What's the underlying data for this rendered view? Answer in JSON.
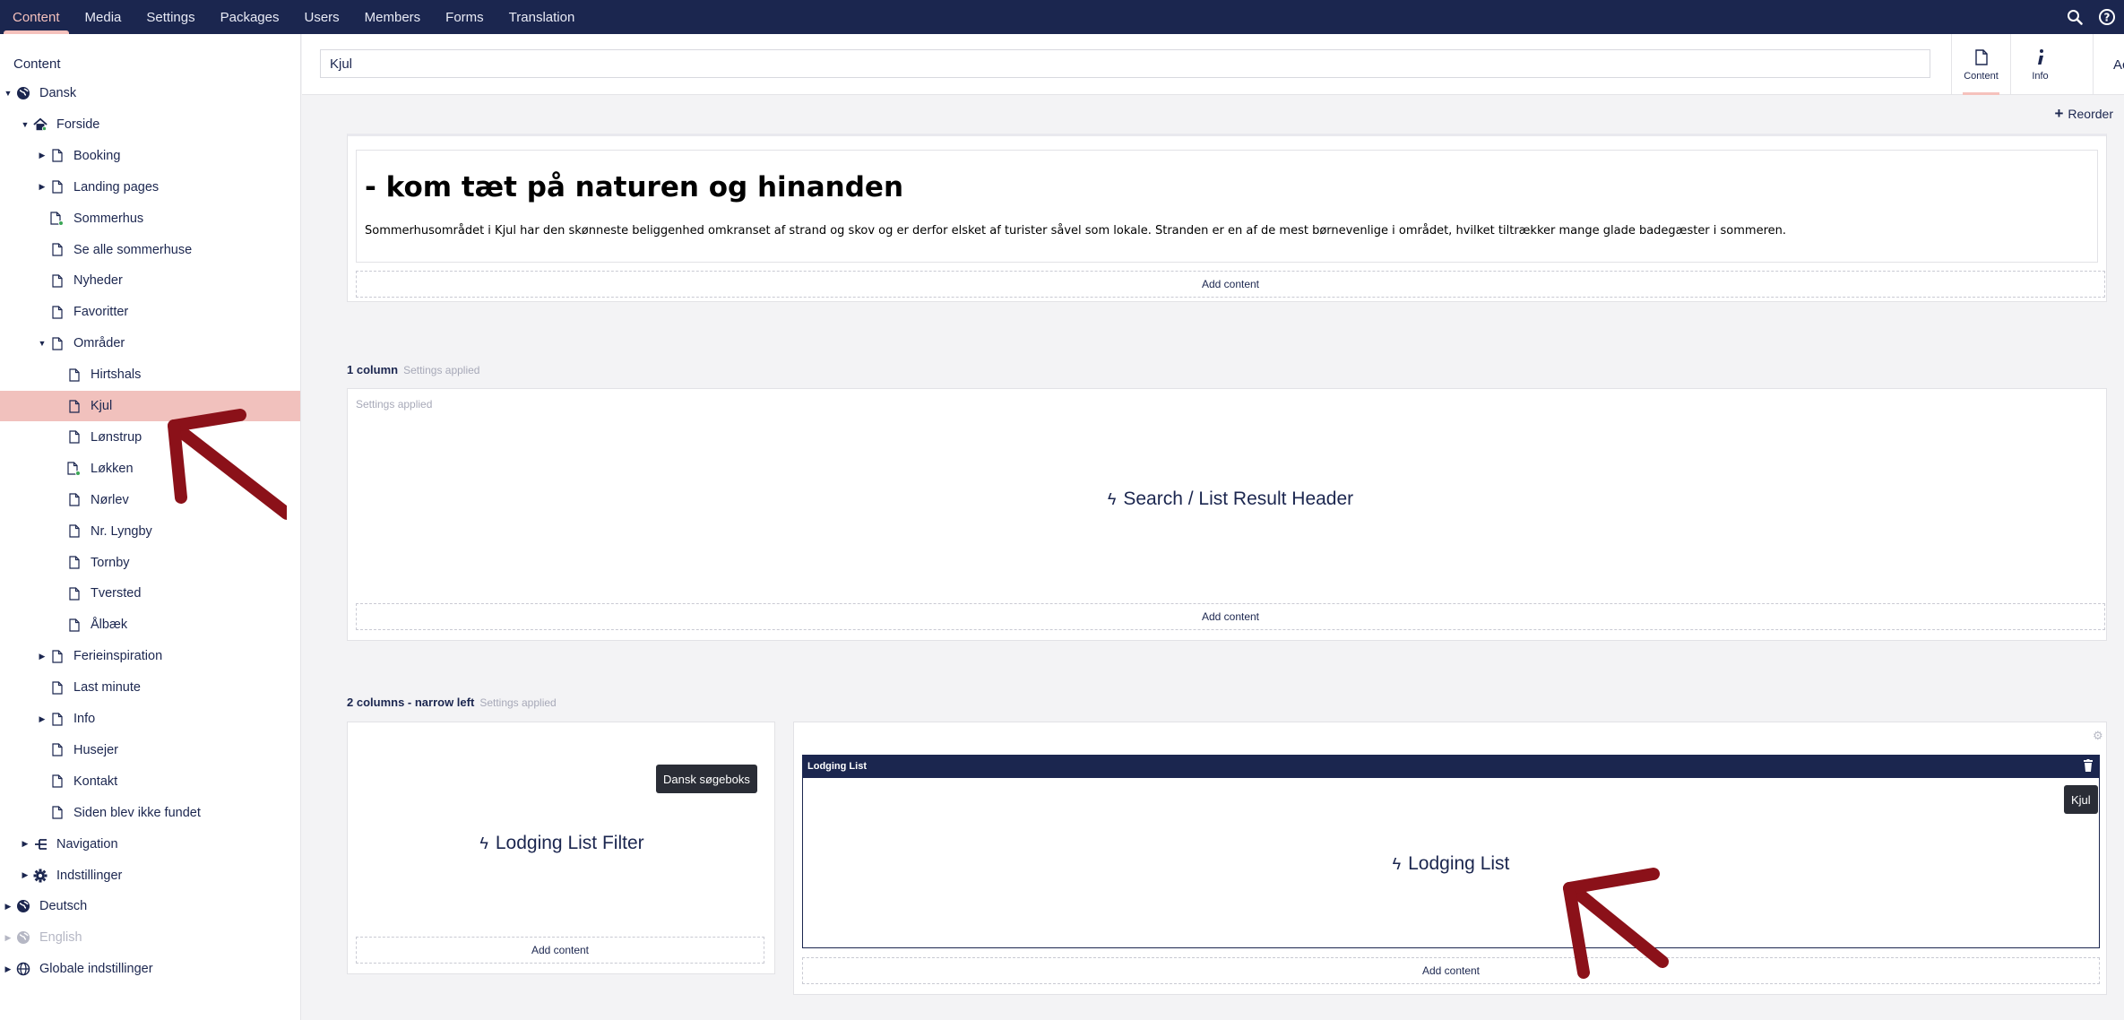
{
  "topnav": {
    "items": [
      "Content",
      "Media",
      "Settings",
      "Packages",
      "Users",
      "Members",
      "Forms",
      "Translation"
    ],
    "active": "Content"
  },
  "sidebar": {
    "title": "Content",
    "tree": [
      {
        "label": "Dansk",
        "icon": "globe-icon",
        "depth": 0,
        "caret": "open"
      },
      {
        "label": "Forside",
        "icon": "home-icon",
        "depth": 1,
        "caret": "open"
      },
      {
        "label": "Booking",
        "icon": "document-icon",
        "depth": 2,
        "caret": "closed"
      },
      {
        "label": "Landing pages",
        "icon": "document-icon",
        "depth": 2,
        "caret": "closed"
      },
      {
        "label": "Sommerhus",
        "icon": "document-dot-icon",
        "depth": 2,
        "caret": "none"
      },
      {
        "label": "Se alle sommerhuse",
        "icon": "document-icon",
        "depth": 2,
        "caret": "none"
      },
      {
        "label": "Nyheder",
        "icon": "document-icon",
        "depth": 2,
        "caret": "none"
      },
      {
        "label": "Favoritter",
        "icon": "document-icon",
        "depth": 2,
        "caret": "none"
      },
      {
        "label": "Områder",
        "icon": "document-icon",
        "depth": 2,
        "caret": "open"
      },
      {
        "label": "Hirtshals",
        "icon": "document-icon",
        "depth": 3,
        "caret": "none"
      },
      {
        "label": "Kjul",
        "icon": "document-icon",
        "depth": 3,
        "caret": "none",
        "selected": true
      },
      {
        "label": "Lønstrup",
        "icon": "document-icon",
        "depth": 3,
        "caret": "none"
      },
      {
        "label": "Løkken",
        "icon": "document-dot-icon",
        "depth": 3,
        "caret": "none"
      },
      {
        "label": "Nørlev",
        "icon": "document-icon",
        "depth": 3,
        "caret": "none"
      },
      {
        "label": "Nr. Lyngby",
        "icon": "document-icon",
        "depth": 3,
        "caret": "none"
      },
      {
        "label": "Tornby",
        "icon": "document-icon",
        "depth": 3,
        "caret": "none"
      },
      {
        "label": "Tversted",
        "icon": "document-icon",
        "depth": 3,
        "caret": "none"
      },
      {
        "label": "Ålbæk",
        "icon": "document-icon",
        "depth": 3,
        "caret": "none"
      },
      {
        "label": "Ferieinspiration",
        "icon": "document-icon",
        "depth": 2,
        "caret": "closed"
      },
      {
        "label": "Last minute",
        "icon": "document-icon",
        "depth": 2,
        "caret": "none"
      },
      {
        "label": "Info",
        "icon": "document-icon",
        "depth": 2,
        "caret": "closed"
      },
      {
        "label": "Husejer",
        "icon": "document-icon",
        "depth": 2,
        "caret": "none"
      },
      {
        "label": "Kontakt",
        "icon": "document-icon",
        "depth": 2,
        "caret": "none"
      },
      {
        "label": "Siden blev ikke fundet",
        "icon": "document-icon",
        "depth": 2,
        "caret": "none"
      },
      {
        "label": "Navigation",
        "icon": "sitemap-icon",
        "depth": 1,
        "caret": "closed"
      },
      {
        "label": "Indstillinger",
        "icon": "gear-icon",
        "depth": 1,
        "caret": "closed"
      },
      {
        "label": "Deutsch",
        "icon": "globe-icon",
        "depth": 0,
        "caret": "closed"
      },
      {
        "label": "English",
        "icon": "globe-icon",
        "depth": 0,
        "caret": "closed",
        "disabled": true
      },
      {
        "label": "Globale indstillinger",
        "icon": "world-icon",
        "depth": 0,
        "caret": "closed"
      }
    ]
  },
  "editor": {
    "name_value": "Kjul",
    "tabs": [
      {
        "label": "Content",
        "icon": "document-icon",
        "active": true
      },
      {
        "label": "Info",
        "icon": "info-icon",
        "active": false
      }
    ],
    "actions_label": "Actio"
  },
  "canvas": {
    "reorder_label": "Reorder",
    "section1": {
      "heading": "- kom tæt på naturen og hinanden",
      "body": "Sommerhusområdet i Kjul har den skønneste beliggenhed omkranset af strand og skov og er derfor elsket af turister såvel som lokale. Stranden er en af de mest børnevenlige i området, hvilket tiltrækker mange glade badegæster i sommeren.",
      "add_content": "Add content"
    },
    "section2": {
      "label": "1 column",
      "settings": "Settings applied",
      "inner_settings": "Settings applied",
      "block": "Search / List Result Header",
      "add_content": "Add content"
    },
    "section3": {
      "label": "2 columns - narrow left",
      "settings": "Settings applied",
      "left_tooltip": "Dansk søgeboks",
      "left_block": "Lodging List Filter",
      "left_add_content": "Add content",
      "right_header": "Lodging List",
      "right_tooltip": "Kjul",
      "right_block": "Lodging List",
      "right_add_content": "Add content"
    }
  },
  "colors": {
    "topbar": "#1b264f",
    "selected": "#f1c1bd",
    "arrow": "#8b1119"
  }
}
